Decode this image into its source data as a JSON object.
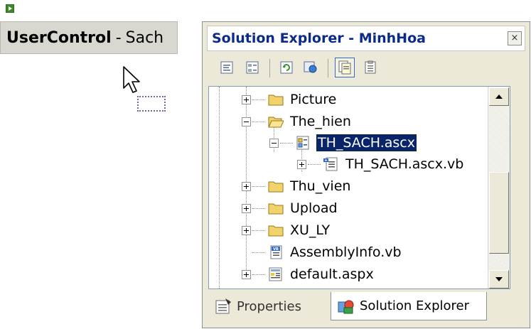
{
  "designer": {
    "control_bold": "UserControl",
    "control_sep": "-",
    "control_name": "Sach"
  },
  "solution_explorer": {
    "title": "Solution Explorer - MinhHoa",
    "close_glyph": "×",
    "tree": [
      {
        "label": "Picture",
        "icon": "folder-icon",
        "expander": "plus"
      },
      {
        "label": "The_hien",
        "icon": "folder-open-icon",
        "expander": "minus"
      },
      {
        "label": "TH_SACH.ascx",
        "icon": "user-control-icon",
        "expander": "minus",
        "selected": true
      },
      {
        "label": "TH_SACH.ascx.vb",
        "icon": "vb-code-icon",
        "expander": "plus"
      },
      {
        "label": "Thu_vien",
        "icon": "folder-icon",
        "expander": "plus"
      },
      {
        "label": "Upload",
        "icon": "folder-icon",
        "expander": "plus"
      },
      {
        "label": "XU_LY",
        "icon": "folder-icon",
        "expander": "plus"
      },
      {
        "label": "AssemblyInfo.vb",
        "icon": "vb-file-icon",
        "expander": "none"
      },
      {
        "label": "default.aspx",
        "icon": "aspx-file-icon",
        "expander": "plus"
      }
    ],
    "tabs": [
      {
        "label": "Properties",
        "icon": "properties-icon"
      },
      {
        "label": "Solution Explorer",
        "icon": "solution-explorer-icon"
      }
    ]
  },
  "colors": {
    "title_text": "#0a2b88",
    "selection": "#0a246a",
    "folder": "#f2d36b"
  }
}
